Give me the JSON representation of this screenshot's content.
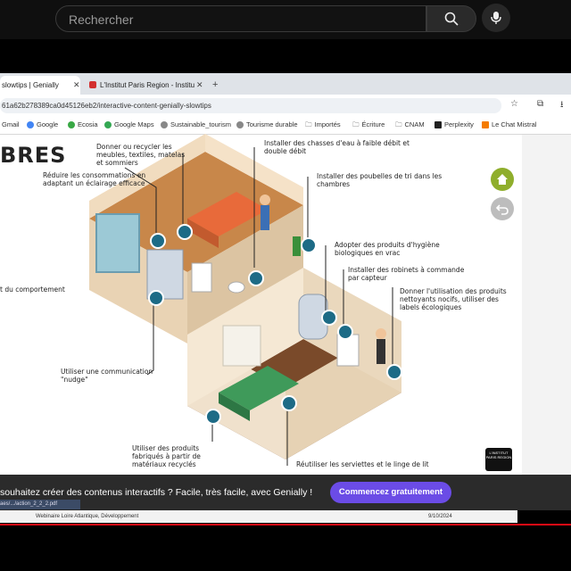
{
  "youtube": {
    "search_placeholder": "Rechercher",
    "icons": {
      "search": "search-icon",
      "mic": "mic-icon"
    }
  },
  "browser": {
    "tabs": [
      {
        "label": "slowtips | Genially",
        "active": true
      },
      {
        "label": "L'Institut Paris Region - Institut",
        "active": false
      }
    ],
    "url": "61a62b278389ca0d45126eb2/interactive-content-genially-slowtips",
    "bookmarks": [
      "Gmail",
      "Google",
      "Ecosia",
      "Google Maps",
      "Sustainable_tourism",
      "Tourisme durable",
      "Importés",
      "Écriture",
      "CNAM",
      "Perplexity",
      "Le Chat Mistral"
    ]
  },
  "genially": {
    "title_fragment": "BRES",
    "left_fragment": "t du comportement",
    "annotations": {
      "a1": "Donner ou recycler les meubles, textiles, matelas et sommiers",
      "a2": "Installer des chasses d'eau à faible débit et double débit",
      "a3": "Réduire les consommations en adaptant un éclairage efficace",
      "a4": "Installer des poubelles de tri dans les chambres",
      "a5": "Adopter des produits d'hygiène biologiques en vrac",
      "a6": "Installer des robinets à commande par capteur",
      "a7": "Donner l'utilisation des produits nettoyants nocifs, utiliser des labels écologiques",
      "a8": "Utiliser une communication \"nudge\"",
      "a9": "Utiliser des produits fabriqués à partir de matériaux recyclés",
      "a10": "Réutiliser les serviettes et le linge de lit"
    },
    "logo_text": "L'INSTITUT PARIS REGION"
  },
  "banner": {
    "text": "souhaitez créer des contenus interactifs ? Facile, très facile, avec Genially !",
    "cta": "Commencez gratuitement",
    "download": "aes/.../action_2_2_2.pdf",
    "status_left": "Webinaire Loire Atlantique, Développement",
    "status_date": "9/10/2024"
  },
  "colors": {
    "accent": "#6b4ce6",
    "home": "#8fae2c",
    "hotspot": "#1d6b86"
  }
}
